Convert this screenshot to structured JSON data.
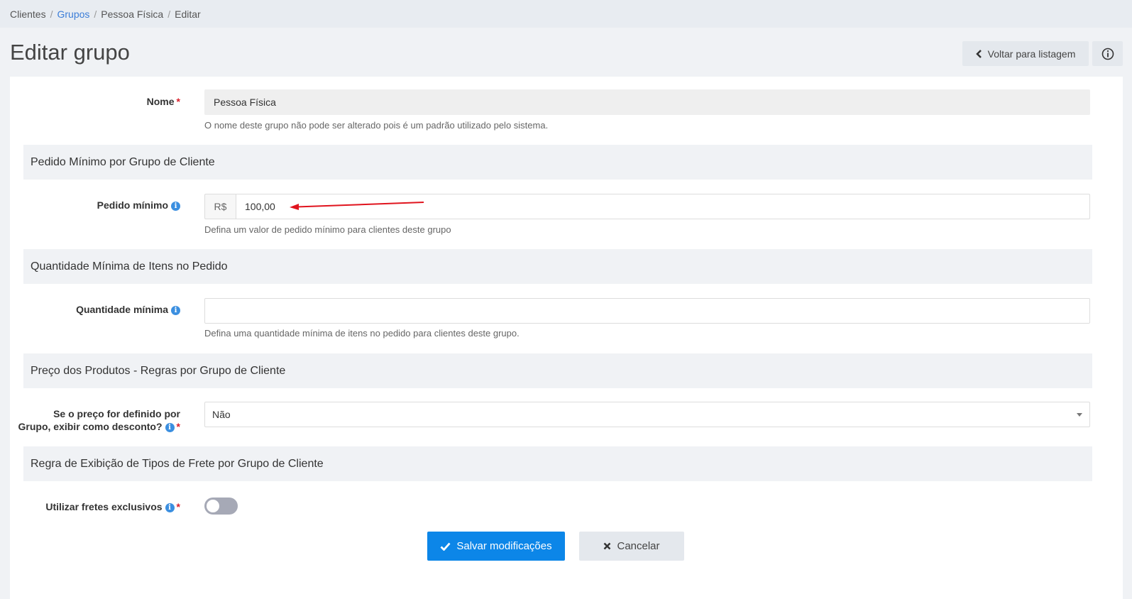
{
  "breadcrumb": {
    "items": [
      "Clientes",
      "Grupos",
      "Pessoa Física",
      "Editar"
    ]
  },
  "header": {
    "title": "Editar grupo",
    "back_label": "Voltar para listagem"
  },
  "form": {
    "nome": {
      "label": "Nome",
      "value": "Pessoa Física",
      "help": "O nome deste grupo não pode ser alterado pois é um padrão utilizado pelo sistema."
    },
    "section_pedido": "Pedido Mínimo por Grupo de Cliente",
    "pedido_minimo": {
      "label": "Pedido mínimo",
      "currency": "R$",
      "value": "100,00",
      "help": "Defina um valor de pedido mínimo para clientes deste grupo"
    },
    "section_quantidade": "Quantidade Mínima de Itens no Pedido",
    "quantidade_minima": {
      "label": "Quantidade mínima",
      "value": "",
      "help": "Defina uma quantidade mínima de itens no pedido para clientes deste grupo."
    },
    "section_preco": "Preço dos Produtos - Regras por Grupo de Cliente",
    "exibir_desconto": {
      "label_line1": "Se o preço for definido por",
      "label_line2": "Grupo, exibir como desconto?",
      "selected": "Não"
    },
    "section_frete": "Regra de Exibição de Tipos de Frete por Grupo de Cliente",
    "fretes_exclusivos": {
      "label": "Utilizar fretes exclusivos",
      "enabled": false
    },
    "required_mark": "*",
    "info_mark": "i"
  },
  "actions": {
    "save_label": "Salvar modificações",
    "cancel_label": "Cancelar"
  },
  "colors": {
    "primary": "#0c86e8",
    "required": "#d9212c",
    "info": "#3b8fe0",
    "arrow": "#e0141e"
  }
}
